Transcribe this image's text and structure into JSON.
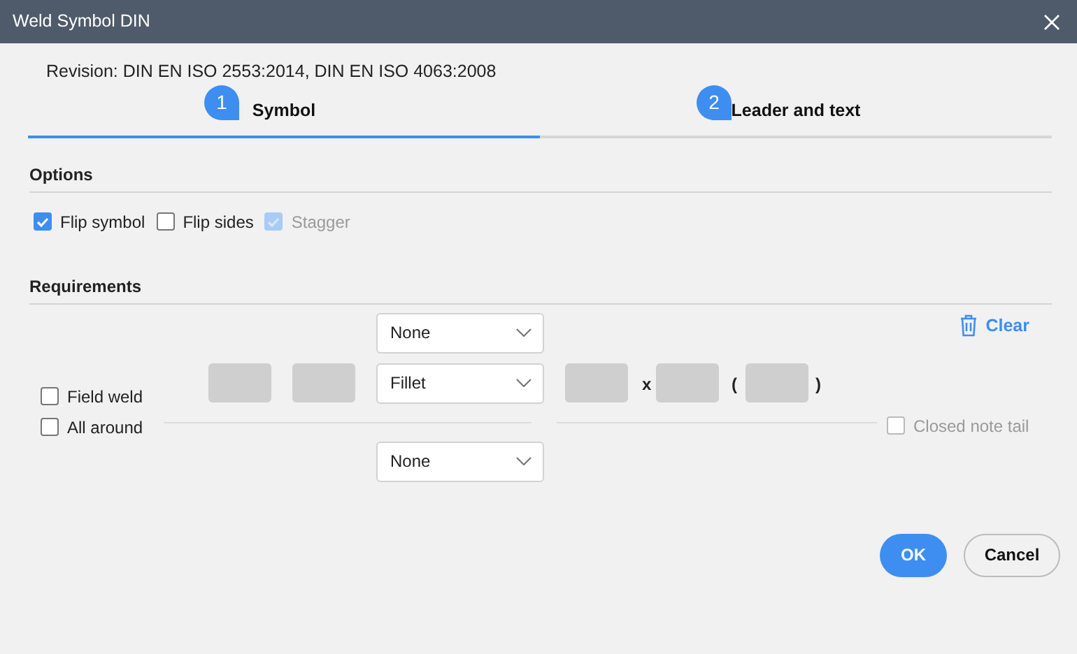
{
  "window": {
    "title": "Weld Symbol DIN"
  },
  "revision": "Revision: DIN EN ISO 2553:2014, DIN EN ISO 4063:2008",
  "tabs": [
    {
      "label": "Symbol",
      "badge": "1",
      "selected": true
    },
    {
      "label": "Leader and text",
      "badge": "2",
      "selected": false
    }
  ],
  "options": {
    "heading": "Options",
    "checkboxes": [
      {
        "label": "Flip symbol",
        "checked": true,
        "disabled": false
      },
      {
        "label": "Flip sides",
        "checked": false,
        "disabled": false
      },
      {
        "label": "Stagger",
        "checked": true,
        "disabled": true
      }
    ]
  },
  "requirements": {
    "heading": "Requirements",
    "clear": "Clear",
    "weld_checkboxes": [
      {
        "label": "Field weld",
        "checked": false,
        "disabled": false
      },
      {
        "label": "All around",
        "checked": false,
        "disabled": false
      }
    ],
    "dropdowns": [
      {
        "value": "None"
      },
      {
        "value": "Fillet"
      },
      {
        "value": "None"
      }
    ],
    "separators": [
      "x",
      "(",
      ")"
    ],
    "closed_note_tail": {
      "label": "Closed note tail",
      "checked": false,
      "disabled": true
    }
  },
  "buttons": [
    {
      "label": "OK",
      "kind": "primary"
    },
    {
      "label": "Cancel",
      "kind": "secondary"
    }
  ]
}
